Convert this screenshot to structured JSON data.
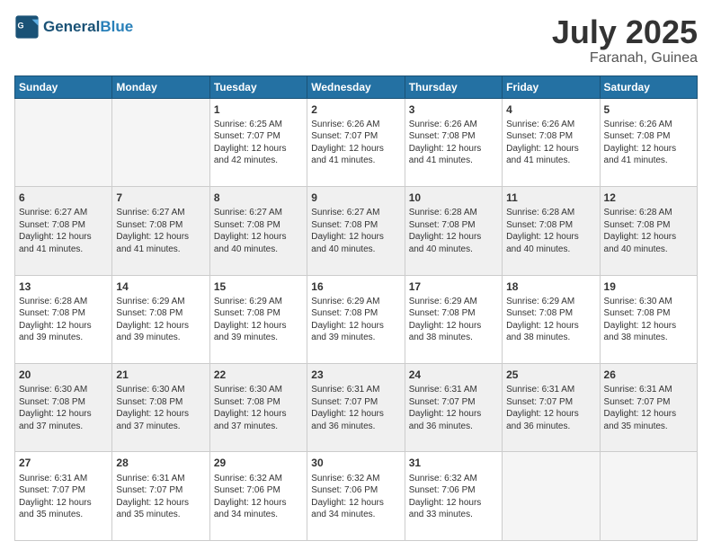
{
  "header": {
    "logo_general": "General",
    "logo_blue": "Blue",
    "month_year": "July 2025",
    "location": "Faranah, Guinea"
  },
  "weekdays": [
    "Sunday",
    "Monday",
    "Tuesday",
    "Wednesday",
    "Thursday",
    "Friday",
    "Saturday"
  ],
  "weeks": [
    [
      {
        "day": "",
        "empty": true
      },
      {
        "day": "",
        "empty": true
      },
      {
        "day": "1",
        "sunrise": "6:25 AM",
        "sunset": "7:07 PM",
        "daylight": "12 hours and 42 minutes."
      },
      {
        "day": "2",
        "sunrise": "6:26 AM",
        "sunset": "7:07 PM",
        "daylight": "12 hours and 41 minutes."
      },
      {
        "day": "3",
        "sunrise": "6:26 AM",
        "sunset": "7:08 PM",
        "daylight": "12 hours and 41 minutes."
      },
      {
        "day": "4",
        "sunrise": "6:26 AM",
        "sunset": "7:08 PM",
        "daylight": "12 hours and 41 minutes."
      },
      {
        "day": "5",
        "sunrise": "6:26 AM",
        "sunset": "7:08 PM",
        "daylight": "12 hours and 41 minutes."
      }
    ],
    [
      {
        "day": "6",
        "sunrise": "6:27 AM",
        "sunset": "7:08 PM",
        "daylight": "12 hours and 41 minutes."
      },
      {
        "day": "7",
        "sunrise": "6:27 AM",
        "sunset": "7:08 PM",
        "daylight": "12 hours and 41 minutes."
      },
      {
        "day": "8",
        "sunrise": "6:27 AM",
        "sunset": "7:08 PM",
        "daylight": "12 hours and 40 minutes."
      },
      {
        "day": "9",
        "sunrise": "6:27 AM",
        "sunset": "7:08 PM",
        "daylight": "12 hours and 40 minutes."
      },
      {
        "day": "10",
        "sunrise": "6:28 AM",
        "sunset": "7:08 PM",
        "daylight": "12 hours and 40 minutes."
      },
      {
        "day": "11",
        "sunrise": "6:28 AM",
        "sunset": "7:08 PM",
        "daylight": "12 hours and 40 minutes."
      },
      {
        "day": "12",
        "sunrise": "6:28 AM",
        "sunset": "7:08 PM",
        "daylight": "12 hours and 40 minutes."
      }
    ],
    [
      {
        "day": "13",
        "sunrise": "6:28 AM",
        "sunset": "7:08 PM",
        "daylight": "12 hours and 39 minutes."
      },
      {
        "day": "14",
        "sunrise": "6:29 AM",
        "sunset": "7:08 PM",
        "daylight": "12 hours and 39 minutes."
      },
      {
        "day": "15",
        "sunrise": "6:29 AM",
        "sunset": "7:08 PM",
        "daylight": "12 hours and 39 minutes."
      },
      {
        "day": "16",
        "sunrise": "6:29 AM",
        "sunset": "7:08 PM",
        "daylight": "12 hours and 39 minutes."
      },
      {
        "day": "17",
        "sunrise": "6:29 AM",
        "sunset": "7:08 PM",
        "daylight": "12 hours and 38 minutes."
      },
      {
        "day": "18",
        "sunrise": "6:29 AM",
        "sunset": "7:08 PM",
        "daylight": "12 hours and 38 minutes."
      },
      {
        "day": "19",
        "sunrise": "6:30 AM",
        "sunset": "7:08 PM",
        "daylight": "12 hours and 38 minutes."
      }
    ],
    [
      {
        "day": "20",
        "sunrise": "6:30 AM",
        "sunset": "7:08 PM",
        "daylight": "12 hours and 37 minutes."
      },
      {
        "day": "21",
        "sunrise": "6:30 AM",
        "sunset": "7:08 PM",
        "daylight": "12 hours and 37 minutes."
      },
      {
        "day": "22",
        "sunrise": "6:30 AM",
        "sunset": "7:08 PM",
        "daylight": "12 hours and 37 minutes."
      },
      {
        "day": "23",
        "sunrise": "6:31 AM",
        "sunset": "7:07 PM",
        "daylight": "12 hours and 36 minutes."
      },
      {
        "day": "24",
        "sunrise": "6:31 AM",
        "sunset": "7:07 PM",
        "daylight": "12 hours and 36 minutes."
      },
      {
        "day": "25",
        "sunrise": "6:31 AM",
        "sunset": "7:07 PM",
        "daylight": "12 hours and 36 minutes."
      },
      {
        "day": "26",
        "sunrise": "6:31 AM",
        "sunset": "7:07 PM",
        "daylight": "12 hours and 35 minutes."
      }
    ],
    [
      {
        "day": "27",
        "sunrise": "6:31 AM",
        "sunset": "7:07 PM",
        "daylight": "12 hours and 35 minutes."
      },
      {
        "day": "28",
        "sunrise": "6:31 AM",
        "sunset": "7:07 PM",
        "daylight": "12 hours and 35 minutes."
      },
      {
        "day": "29",
        "sunrise": "6:32 AM",
        "sunset": "7:06 PM",
        "daylight": "12 hours and 34 minutes."
      },
      {
        "day": "30",
        "sunrise": "6:32 AM",
        "sunset": "7:06 PM",
        "daylight": "12 hours and 34 minutes."
      },
      {
        "day": "31",
        "sunrise": "6:32 AM",
        "sunset": "7:06 PM",
        "daylight": "12 hours and 33 minutes."
      },
      {
        "day": "",
        "empty": true
      },
      {
        "day": "",
        "empty": true
      }
    ]
  ]
}
